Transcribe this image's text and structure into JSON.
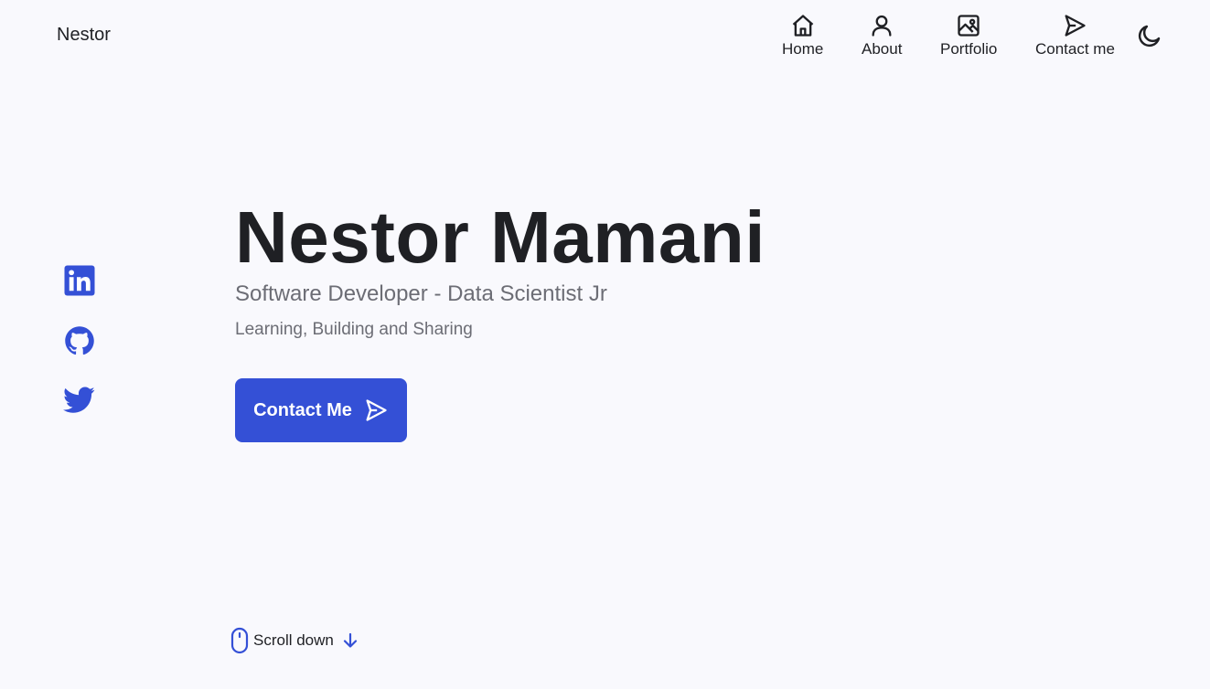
{
  "header": {
    "brand": "Nestor",
    "nav": [
      {
        "label": "Home",
        "icon": "home-icon"
      },
      {
        "label": "About",
        "icon": "user-icon"
      },
      {
        "label": "Portfolio",
        "icon": "image-icon"
      },
      {
        "label": "Contact me",
        "icon": "send-icon"
      }
    ],
    "theme_icon": "moon-icon"
  },
  "social": [
    {
      "name": "LinkedIn",
      "icon": "linkedin-icon"
    },
    {
      "name": "GitHub",
      "icon": "github-icon"
    },
    {
      "name": "Twitter",
      "icon": "twitter-icon"
    }
  ],
  "hero": {
    "name": "Nestor Mamani",
    "subtitle": "Software Developer - Data Scientist Jr",
    "description": "Learning, Building and Sharing",
    "cta_label": "Contact Me"
  },
  "scroll": {
    "label": "Scroll down"
  },
  "colors": {
    "accent": "#3450d6",
    "background": "#f9f9fd",
    "text": "#1f2024",
    "muted": "#6c6d75"
  }
}
